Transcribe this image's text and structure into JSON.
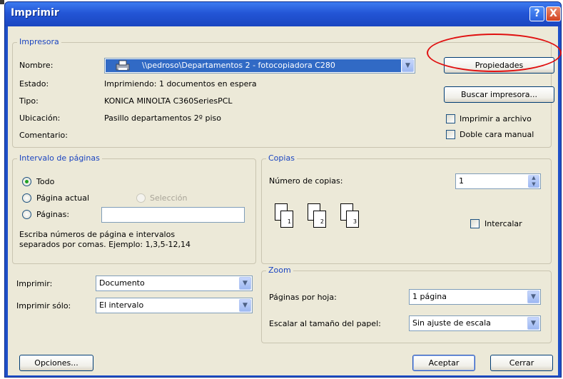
{
  "window": {
    "title": "Imprimir",
    "help_glyph": "?",
    "close_glyph": "X"
  },
  "printer": {
    "group_title": "Impresora",
    "name_label": "Nombre:",
    "name_value": "\\\\pedroso\\Departamentos 2 - fotocopiadora C280",
    "status_label": "Estado:",
    "status_value": "Imprimiendo: 1 documentos en espera",
    "type_label": "Tipo:",
    "type_value": "KONICA MINOLTA C360SeriesPCL",
    "location_label": "Ubicación:",
    "location_value": "Pasillo departamentos 2º piso",
    "comment_label": "Comentario:",
    "properties_button": "Propiedades",
    "find_printer_button": "Buscar impresora...",
    "print_to_file_label": "Imprimir a archivo",
    "manual_duplex_label": "Doble cara manual"
  },
  "page_range": {
    "group_title": "Intervalo de páginas",
    "all_label": "Todo",
    "current_label": "Página actual",
    "selection_label": "Selección",
    "pages_label": "Páginas:",
    "pages_value": "",
    "hint_line1": "Escriba números de página e intervalos",
    "hint_line2": "separados por comas. Ejemplo: 1,3,5-12,14",
    "selected": "all"
  },
  "copies": {
    "group_title": "Copias",
    "count_label": "Número de copias:",
    "count_value": "1",
    "collate_label": "Intercalar",
    "page_numbers": [
      "1",
      "2",
      "3"
    ]
  },
  "print_options": {
    "print_label": "Imprimir:",
    "print_value": "Documento",
    "print_only_label": "Imprimir sólo:",
    "print_only_value": "El intervalo"
  },
  "zoom": {
    "group_title": "Zoom",
    "pages_per_sheet_label": "Páginas por hoja:",
    "pages_per_sheet_value": "1 página",
    "scale_label": "Escalar al tamaño del papel:",
    "scale_value": "Sin ajuste de escala"
  },
  "footer": {
    "options_button": "Opciones...",
    "ok_button": "Aceptar",
    "cancel_button": "Cerrar"
  },
  "colors": {
    "titlebar": "#2355d6",
    "dialog_bg": "#ece9d8",
    "group_title": "#1a44c0",
    "highlight": "#316ac5",
    "annotation": "#e01010"
  }
}
